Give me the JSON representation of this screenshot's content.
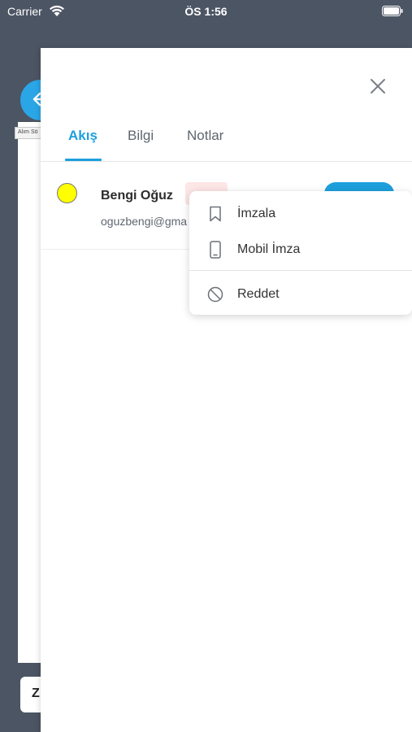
{
  "status_bar": {
    "carrier": "Carrier",
    "time": "ÖS 1:56"
  },
  "background": {
    "tooltip": "Alım Sö",
    "bottom_button": "Z"
  },
  "sheet": {
    "tabs": [
      {
        "label": "Akış",
        "active": true
      },
      {
        "label": "Bilgi",
        "active": false
      },
      {
        "label": "Notlar",
        "active": false
      }
    ],
    "signer": {
      "name": "Bengi Oğuz",
      "email": "oguzbengi@gma",
      "status_color": "#ffff00"
    }
  },
  "menu": {
    "items": [
      {
        "label": "İmzala",
        "icon": "bookmark-icon"
      },
      {
        "label": "Mobil İmza",
        "icon": "mobile-phone-icon"
      },
      {
        "label": "Reddet",
        "icon": "block-icon"
      }
    ]
  },
  "colors": {
    "accent": "#1ea0dd",
    "backdrop": "#4c5563"
  }
}
